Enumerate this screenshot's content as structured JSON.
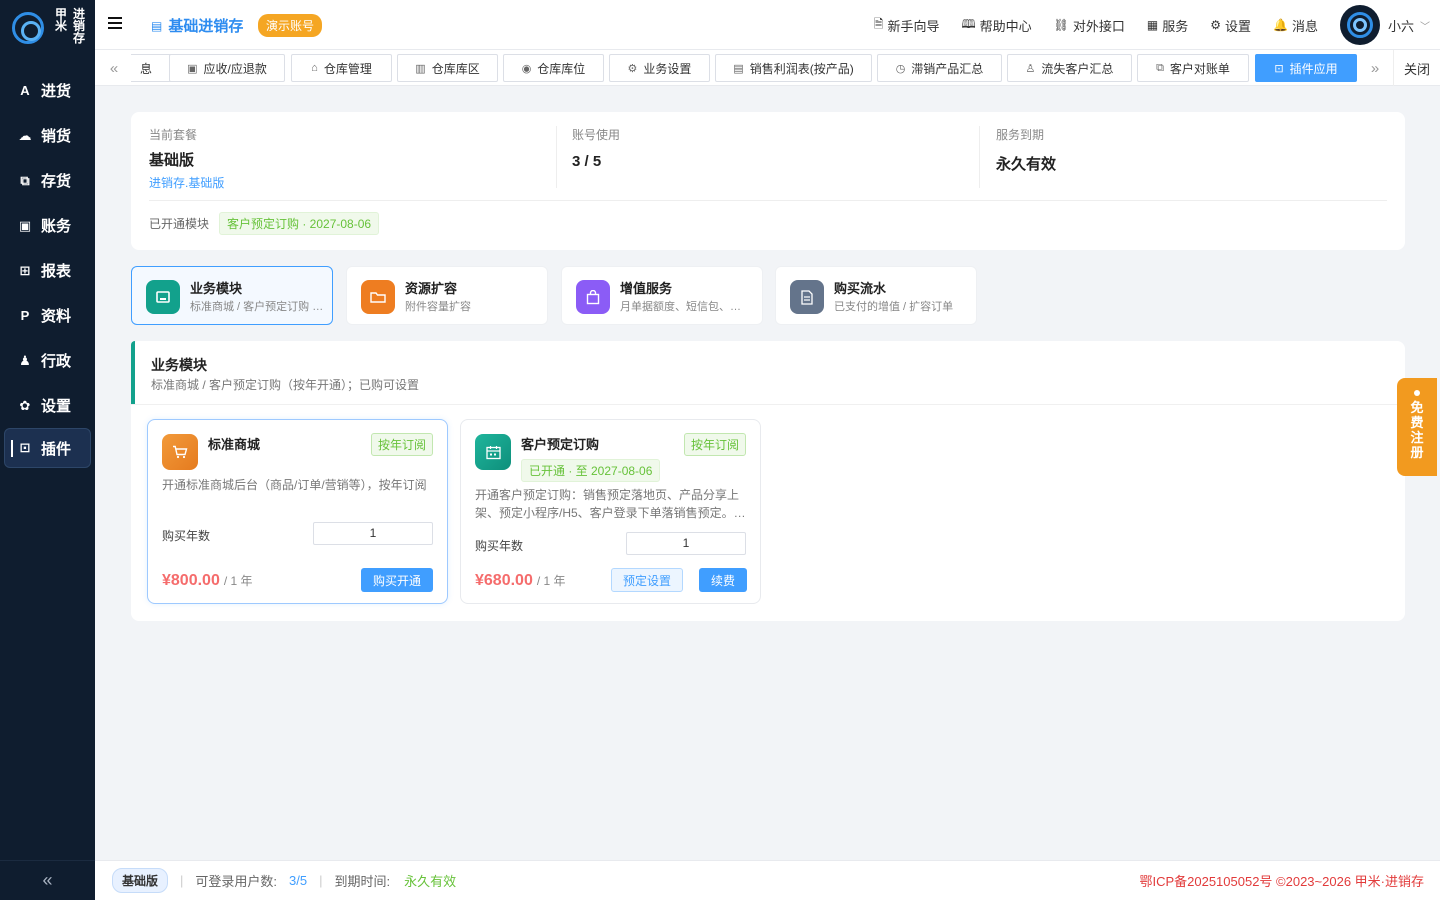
{
  "brand": {
    "logo_chars": [
      "甲",
      "进",
      "米",
      "销",
      "",
      "存"
    ]
  },
  "sidebar": {
    "items": [
      {
        "label": "进货",
        "icon": "A"
      },
      {
        "label": "销货",
        "icon": "☁"
      },
      {
        "label": "存货",
        "icon": "⧉"
      },
      {
        "label": "账务",
        "icon": "▣"
      },
      {
        "label": "报表",
        "icon": "⊞"
      },
      {
        "label": "资料",
        "icon": "P"
      },
      {
        "label": "行政",
        "icon": "♟"
      },
      {
        "label": "设置",
        "icon": "✿"
      },
      {
        "label": "插件",
        "icon": "⊡"
      }
    ],
    "active_index": 8,
    "collapse_icon": "«"
  },
  "header": {
    "app_title": "基础进销存",
    "demo_badge": "演示账号",
    "links": [
      {
        "label": "新手向导",
        "icon": "🗎"
      },
      {
        "label": "帮助中心",
        "icon": "🕮"
      },
      {
        "label": "对外接口",
        "icon": "⛓"
      },
      {
        "label": "服务",
        "icon": "▦"
      },
      {
        "label": "设置",
        "icon": "⚙"
      },
      {
        "label": "消息",
        "icon": "🔔"
      }
    ],
    "username": "小六"
  },
  "tabs": {
    "items": [
      "息",
      "应收/应退款",
      "仓库管理",
      "仓库库区",
      "仓库库位",
      "业务设置",
      "销售利润表(按产品)",
      "滞销产品汇总",
      "流失客户汇总",
      "客户对账单",
      "插件应用"
    ],
    "active": "插件应用",
    "close_label": "关闭"
  },
  "summary": {
    "plan_label": "当前套餐",
    "plan_value": "基础版",
    "plan_sub": "进销存.基础版",
    "accounts_label": "账号使用",
    "accounts_value": "3 / 5",
    "expire_label": "服务到期",
    "expire_value": "永久有效",
    "modules_label": "已开通模块",
    "module_tag": "客户预定订购 · 2027-08-06"
  },
  "categories": [
    {
      "title": "业务模块",
      "sub": "标准商城 / 客户预定订购 (按年开通)",
      "color": "#12a18c",
      "icon": "store-icon"
    },
    {
      "title": "资源扩容",
      "sub": "附件容量扩容",
      "color": "#ee7d21",
      "icon": "folder-icon"
    },
    {
      "title": "增值服务",
      "sub": "月单据额度、短信包、…",
      "color": "#8b5cf6",
      "icon": "bag-icon"
    },
    {
      "title": "购买流水",
      "sub": "已支付的增值 / 扩容订单",
      "color": "#64748b",
      "icon": "document-icon"
    }
  ],
  "business": {
    "title": "业务模块",
    "subtitle": "标准商城 / 客户预定订购（按年开通）；已购可设置",
    "products": [
      {
        "title": "标准商城",
        "tag": "按年订阅",
        "desc": "开通标准商城后台（商品/订单/营销等），按年订阅",
        "qty_label": "购买年数",
        "qty": "1",
        "price": "¥800.00",
        "unit": "/ 1 年",
        "buy_label": "购买开通"
      },
      {
        "title": "客户预定订购",
        "tag": "按年订阅",
        "open_tag": "已开通 · 至 2027-08-06",
        "desc": "开通客户预定订购：销售预定落地页、产品分享上架、预定小程序/H5、客户登录下单落销售预定。…",
        "qty_label": "购买年数",
        "qty": "1",
        "price": "¥680.00",
        "unit": "/ 1 年",
        "settings_label": "预定设置",
        "renew_label": "续费"
      }
    ]
  },
  "float_register": [
    "免",
    "费",
    "注",
    "册"
  ],
  "footer": {
    "badge": "基础版",
    "users_label": "可登录用户数:",
    "users_value": "3/5",
    "expire_label": "到期时间:",
    "expire_value": "永久有效",
    "copyright": "鄂ICP备2025105052号 ©2023~2026 甲米·进销存"
  },
  "colors": {
    "primary": "#409eff",
    "sidebar_bg": "#0f1d2f",
    "accent_orange": "#f29a1f",
    "price_red": "#f56c6c",
    "success_green": "#67c23a"
  }
}
